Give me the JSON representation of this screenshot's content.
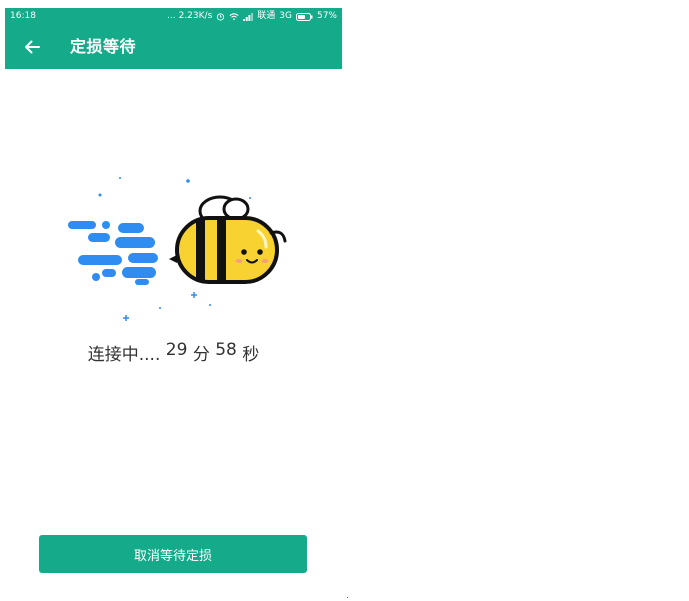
{
  "status_bar": {
    "time": "16:18",
    "network_speed": "... 2.23K/s",
    "carrier": "联通",
    "network_type": "3G",
    "battery": "57%"
  },
  "app_bar": {
    "title": "定损等待",
    "back_icon": "arrow-left-icon"
  },
  "illustration": {
    "icon": "bee-icon",
    "accent_blue": "#2f8cf0",
    "bee_yellow": "#f7d230"
  },
  "status": {
    "connecting_label": "连接中....",
    "minutes": "29",
    "minutes_unit": "分",
    "seconds": "58",
    "seconds_unit": "秒"
  },
  "actions": {
    "cancel_label": "取消等待定损"
  },
  "colors": {
    "primary": "#15ab8a",
    "text": "#333333"
  }
}
